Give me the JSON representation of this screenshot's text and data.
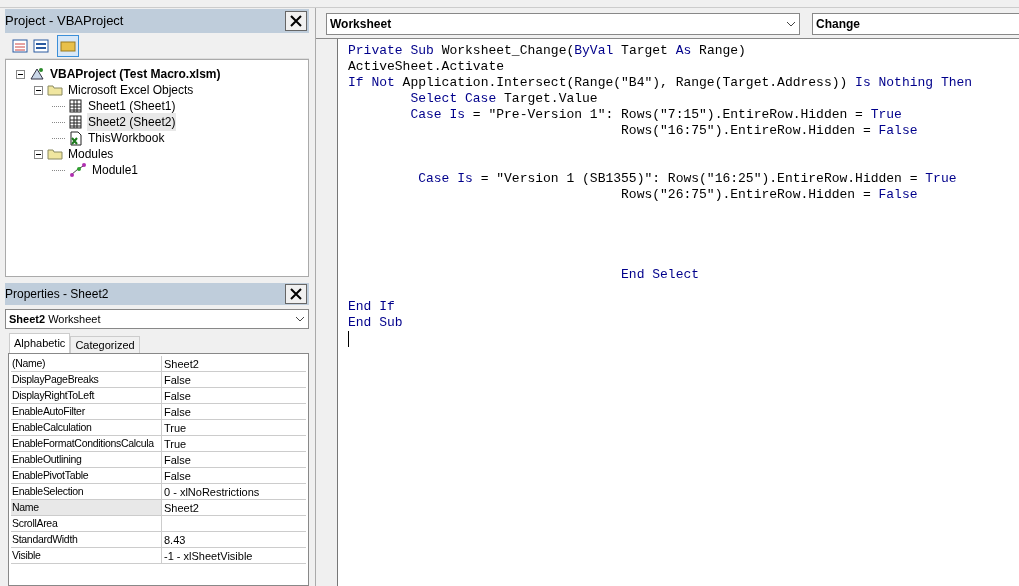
{
  "project_panel": {
    "title": "Project - VBAProject",
    "tree": [
      {
        "label": "VBAProject (Test Macro.xlsm)",
        "kind": "project",
        "expanded": true,
        "selected": false,
        "children": [
          {
            "label": "Microsoft Excel Objects",
            "kind": "folder",
            "expanded": true,
            "selected": false,
            "children": [
              {
                "label": "Sheet1 (Sheet1)",
                "kind": "sheet",
                "selected": false
              },
              {
                "label": "Sheet2 (Sheet2)",
                "kind": "sheet",
                "selected": true
              },
              {
                "label": "ThisWorkbook",
                "kind": "workbook",
                "selected": false
              }
            ]
          },
          {
            "label": "Modules",
            "kind": "folder",
            "expanded": true,
            "selected": false,
            "children": [
              {
                "label": "Module1",
                "kind": "module",
                "selected": false
              }
            ]
          }
        ]
      }
    ]
  },
  "properties_panel": {
    "title": "Properties - Sheet2",
    "object_name": "Sheet2",
    "object_type": "Worksheet",
    "tabs": [
      {
        "label": "Alphabetic",
        "selected": true
      },
      {
        "label": "Categorized",
        "selected": false
      }
    ],
    "rows": [
      {
        "name": "(Name)",
        "value": "Sheet2",
        "selected": false
      },
      {
        "name": "DisplayPageBreaks",
        "value": "False",
        "selected": false
      },
      {
        "name": "DisplayRightToLeft",
        "value": "False",
        "selected": false
      },
      {
        "name": "EnableAutoFilter",
        "value": "False",
        "selected": false
      },
      {
        "name": "EnableCalculation",
        "value": "True",
        "selected": false
      },
      {
        "name": "EnableFormatConditionsCalcula",
        "value": "True",
        "selected": false
      },
      {
        "name": "EnableOutlining",
        "value": "False",
        "selected": false
      },
      {
        "name": "EnablePivotTable",
        "value": "False",
        "selected": false
      },
      {
        "name": "EnableSelection",
        "value": "0 - xlNoRestrictions",
        "selected": false
      },
      {
        "name": "Name",
        "value": "Sheet2",
        "selected": true
      },
      {
        "name": "ScrollArea",
        "selected": false
      },
      {
        "name": "StandardWidth",
        "value": "8.43",
        "selected": false
      },
      {
        "name": "Visible",
        "value": "-1 - xlSheetVisible",
        "selected": false
      }
    ]
  },
  "code_window": {
    "object_dropdown": "Worksheet",
    "procedure_dropdown": "Change",
    "lines": [
      {
        "kind": "line",
        "tokens": [
          {
            "text": "Private Sub",
            "kind": "keyword"
          },
          {
            "text": " Worksheet_Change(",
            "kind": "plain"
          },
          {
            "text": "ByVal",
            "kind": "keyword"
          },
          {
            "text": " Target ",
            "kind": "plain"
          },
          {
            "text": "As",
            "kind": "keyword"
          },
          {
            "text": " Range)",
            "kind": "plain"
          }
        ]
      },
      {
        "kind": "line",
        "tokens": [
          {
            "text": "ActiveSheet.Activate",
            "kind": "plain"
          }
        ]
      },
      {
        "kind": "line",
        "tokens": [
          {
            "text": "If Not",
            "kind": "keyword"
          },
          {
            "text": " Application.Intersect(Range(\"B4\"), Range(Target.Address)) ",
            "kind": "plain"
          },
          {
            "text": "Is Nothing Then",
            "kind": "keyword"
          }
        ]
      },
      {
        "kind": "line",
        "tokens": [
          {
            "text": "        Select Case",
            "kind": "keyword"
          },
          {
            "text": " Target.Value",
            "kind": "plain"
          }
        ]
      },
      {
        "kind": "line",
        "tokens": [
          {
            "text": "        Case Is",
            "kind": "keyword"
          },
          {
            "text": " = \"Pre-Version 1\": Rows(\"7:15\").EntireRow.Hidden = ",
            "kind": "plain"
          },
          {
            "text": "True",
            "kind": "keyword"
          }
        ]
      },
      {
        "kind": "line",
        "tokens": [
          {
            "text": "                                   Rows(\"16:75\").EntireRow.Hidden = ",
            "kind": "plain"
          },
          {
            "text": "False",
            "kind": "keyword"
          }
        ]
      },
      {
        "kind": "spaced",
        "tokens": [
          {
            "text": "         Case Is",
            "kind": "keyword"
          },
          {
            "text": " = \"Version 1 (SB1355)\": Rows(\"16:25\").EntireRow.Hidden = ",
            "kind": "plain"
          },
          {
            "text": "True",
            "kind": "keyword"
          }
        ]
      },
      {
        "kind": "line",
        "tokens": [
          {
            "text": "                                   Rows(\"26:75\").EntireRow.Hidden = ",
            "kind": "plain"
          },
          {
            "text": "False",
            "kind": "keyword"
          }
        ]
      },
      {
        "kind": "far",
        "tokens": [
          {
            "text": "                                   End Select",
            "kind": "keyword"
          }
        ]
      },
      {
        "kind": "gapped",
        "tokens": [
          {
            "text": "End If",
            "kind": "keyword"
          }
        ]
      },
      {
        "kind": "line",
        "tokens": [
          {
            "text": "End Sub",
            "kind": "keyword"
          }
        ]
      }
    ]
  }
}
